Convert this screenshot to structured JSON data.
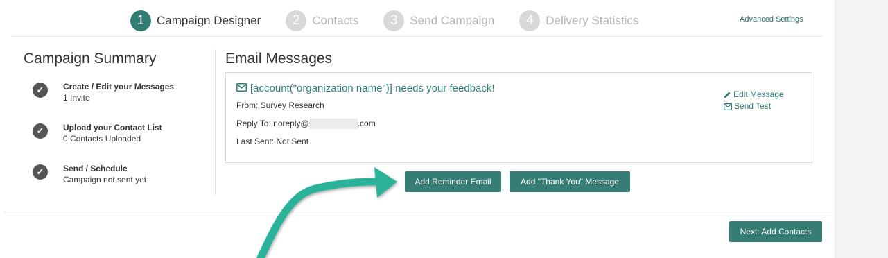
{
  "stepper": {
    "steps": [
      {
        "num": "1",
        "label": "Campaign Designer",
        "active": true
      },
      {
        "num": "2",
        "label": "Contacts",
        "active": false
      },
      {
        "num": "3",
        "label": "Send Campaign",
        "active": false
      },
      {
        "num": "4",
        "label": "Delivery Statistics",
        "active": false
      }
    ],
    "advanced_settings": "Advanced Settings"
  },
  "summary": {
    "title": "Campaign Summary",
    "items": [
      {
        "heading": "Create / Edit your Messages",
        "sub": "1 Invite"
      },
      {
        "heading": "Upload your Contact List",
        "sub": "0 Contacts Uploaded"
      },
      {
        "heading": "Send / Schedule",
        "sub": "Campaign not sent yet"
      }
    ]
  },
  "email": {
    "title": "Email Messages",
    "subject": "[account(\"organization name\")] needs your feedback!",
    "from": "From: Survey Research",
    "reply_to_prefix": "Reply To: noreply@",
    "reply_to_suffix": ".com",
    "last_sent": "Last Sent: Not Sent",
    "edit_label": "Edit Message",
    "test_label": "Send Test"
  },
  "buttons": {
    "reminder": "Add Reminder Email",
    "thank_you": "Add \"Thank You\" Message",
    "next": "Next: Add Contacts"
  },
  "colors": {
    "accent": "#357d75",
    "link": "#2e7d74",
    "arrow": "#2bb39a"
  },
  "icons": [
    "envelope-icon",
    "pencil-icon",
    "check-circle-icon",
    "arrow-annotation"
  ]
}
